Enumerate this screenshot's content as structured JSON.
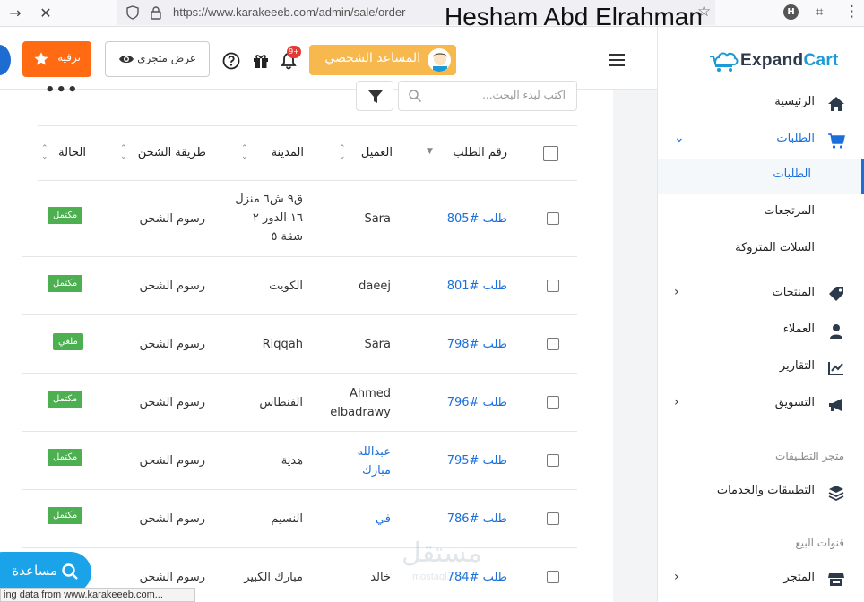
{
  "browser": {
    "url": "https://www.karakeeeb.com/admin/sale/order",
    "overlay_text": "Hesham Abd Elrahman",
    "ext_letter": "H",
    "status_text": "ing data from www.karakeeeb.com..."
  },
  "brand": {
    "name_prefix": "Expand",
    "name_suffix": "Cart",
    "accent": "#1c9ad6"
  },
  "sidebar": {
    "home": "الرئيسية",
    "orders": "الطلبات",
    "orders_sub": [
      "الطلبات",
      "المرتجعات",
      "السلات المتروكة"
    ],
    "products": "المنتجات",
    "customers": "العملاء",
    "reports": "التقارير",
    "marketing": "التسويق",
    "app_store_title": "متجر التطبيقات",
    "apps": "التطبيقات والخدمات",
    "channels_title": "قنوات البيع",
    "store": "المتجر"
  },
  "header": {
    "assistant": "المساعد الشخصي",
    "notifications_badge": "9+",
    "view_store": "عرض متجرى",
    "upgrade": "ترقية"
  },
  "toolbar": {
    "search_placeholder": "اكتب لبدء البحث...",
    "more": "•••"
  },
  "table": {
    "headers": {
      "order_no": "رقم الطلب",
      "customer": "العميل",
      "city": "المدينة",
      "shipping": "طريقة الشحن",
      "status": "الحالة"
    },
    "rows": [
      {
        "order": "طلب #805",
        "customer": "Sara",
        "city": "ق٩ ش٦ منزل ١٦ الدور ٢ شقة ٥",
        "shipping": "رسوم الشحن",
        "status": "مكتمل",
        "customer_link": false
      },
      {
        "order": "طلب #801",
        "customer": "daeej",
        "city": "الكويت",
        "shipping": "رسوم الشحن",
        "status": "مكتمل",
        "customer_link": false
      },
      {
        "order": "طلب #798",
        "customer": "Sara",
        "city": "Riqqah",
        "shipping": "رسوم الشحن",
        "status": "ملغي",
        "customer_link": false
      },
      {
        "order": "طلب #796",
        "customer": "Ahmed elbadrawy",
        "city": "الفنطاس",
        "shipping": "رسوم الشحن",
        "status": "مكتمل",
        "customer_link": false
      },
      {
        "order": "طلب #795",
        "customer": "عبدالله مبارك",
        "city": "هدية",
        "shipping": "رسوم الشحن",
        "status": "مكتمل",
        "customer_link": true
      },
      {
        "order": "طلب #786",
        "customer": "في",
        "city": "النسيم",
        "shipping": "رسوم الشحن",
        "status": "مكتمل",
        "customer_link": true
      },
      {
        "order": "طلب #784",
        "customer": "خالد",
        "city": "مبارك الكبير",
        "shipping": "رسوم الشحن",
        "status": "",
        "customer_link": false
      }
    ]
  },
  "float_assistant": "مساعدة",
  "watermark": {
    "big": "مستقل",
    "small": "mostaql.com"
  },
  "colors": {
    "link": "#1a6fdb",
    "badge_green": "#4caf50",
    "upgrade": "#ff6a13",
    "assistant": "#f7b84e"
  }
}
